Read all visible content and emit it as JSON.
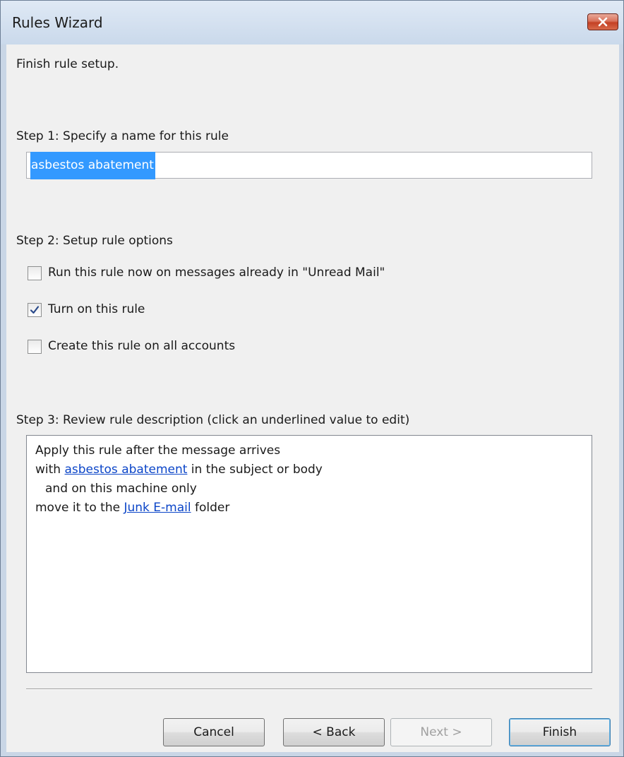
{
  "window": {
    "title": "Rules Wizard"
  },
  "intro": "Finish rule setup.",
  "step1": {
    "label": "Step 1: Specify a name for this rule",
    "rule_name": "asbestos abatement"
  },
  "step2": {
    "label": "Step 2: Setup rule options",
    "options": [
      {
        "label": "Run this rule now on messages already in \"Unread Mail\"",
        "checked": false
      },
      {
        "label": "Turn on this rule",
        "checked": true
      },
      {
        "label": "Create this rule on all accounts",
        "checked": false
      }
    ]
  },
  "step3": {
    "label": "Step 3: Review rule description (click an underlined value to edit)",
    "lines": {
      "l1": "Apply this rule after the message arrives",
      "l2_pre": "with ",
      "l2_link": "asbestos abatement",
      "l2_post": " in the subject or body",
      "l3": "and on this machine only",
      "l4_pre": "move it to the ",
      "l4_link": "Junk E-mail",
      "l4_post": " folder"
    }
  },
  "buttons": {
    "cancel": "Cancel",
    "back": "< Back",
    "next": "Next >",
    "finish": "Finish"
  },
  "colors": {
    "link": "#0b45c8",
    "selection": "#3399ff",
    "close_button": "#c44124"
  }
}
